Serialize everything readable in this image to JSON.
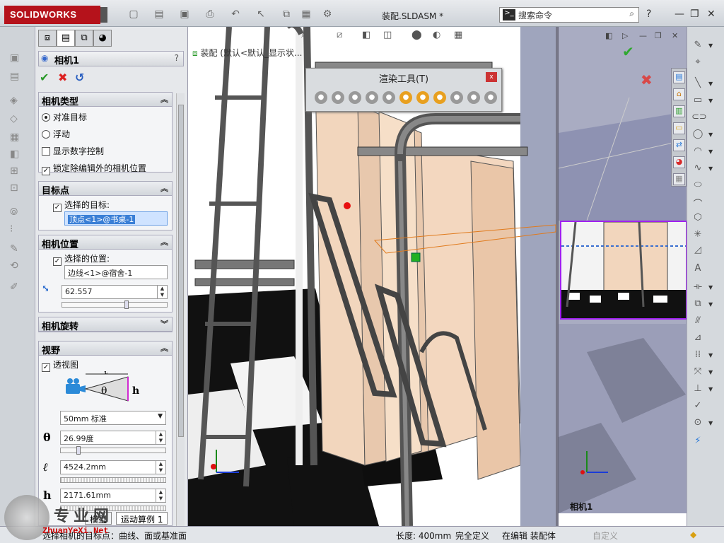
{
  "app": {
    "brand": "SOLIDWORKS",
    "document_title": "装配.SLDASM *"
  },
  "search": {
    "placeholder": "搜索命令"
  },
  "panel": {
    "title": "相机1",
    "help": "?",
    "sections": {
      "camera_type": {
        "title": "相机类型",
        "option_aim": "对准目标",
        "option_float": "浮动",
        "show_numeric": "显示数字控制",
        "lock_pos": "锁定除编辑外的相机位置"
      },
      "target": {
        "title": "目标点",
        "select_target": "选择的目标:",
        "target_value": "顶点<1>@书桌-1"
      },
      "position": {
        "title": "相机位置",
        "select_position": "选择的位置:",
        "position_value": "边线<1>@宿舍-1",
        "distance_value": "62.557"
      },
      "rotation": {
        "title": "相机旋转"
      },
      "fov": {
        "title": "视野",
        "perspective": "透视图",
        "lens_value": "50mm 标准",
        "theta_label": "θ",
        "theta_value": "26.99度",
        "l_label": "ℓ",
        "l_value": "4524.2mm",
        "h_label": "h",
        "h_value": "2171.61mm"
      }
    }
  },
  "viewport": {
    "breadcrumb": "装配 (默认<默认_显示状..."
  },
  "render_toolbar": {
    "title": "渲染工具(T)",
    "close": "x"
  },
  "preview": {
    "label": "相机1"
  },
  "bottom_tabs": [
    "模型",
    "运动算例 1"
  ],
  "status": {
    "left": "选择相机的目标点：曲线、面或基准面",
    "length": "长度: 400mm",
    "defined": "完全定义",
    "editing": "在编辑 装配体",
    "custom": "自定义"
  },
  "watermark": {
    "text": "专业网",
    "url": "ZhuanYeXi.Net"
  },
  "colors": {
    "brand_red": "#b5121b",
    "preview_border": "#a020f0",
    "selection_blue": "#3a7fd6"
  }
}
